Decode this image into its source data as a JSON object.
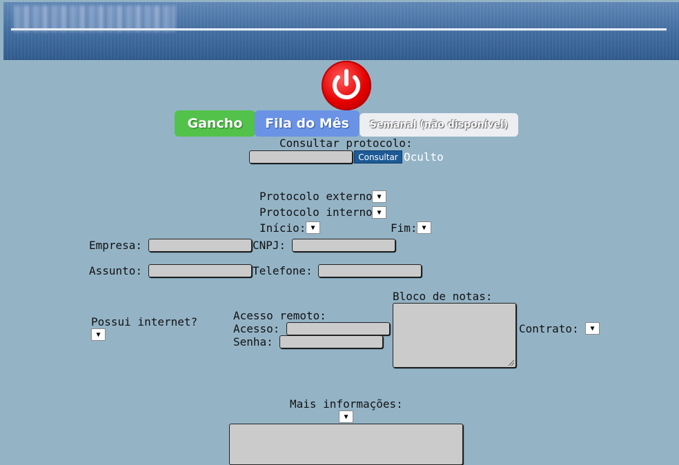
{
  "header": {
    "title_blurred": ""
  },
  "tabs": [
    {
      "label": "Gancho"
    },
    {
      "label": "Fila do Mês"
    },
    {
      "label": "Semanal (não disponível)"
    }
  ],
  "consulta": {
    "label": "Consultar protocolo:",
    "input_value": "",
    "button_label": "Consultar",
    "status_text": "Oculto"
  },
  "filters": {
    "protocolo_externo": "Protocolo externo",
    "protocolo_interno": "Protocolo interno",
    "inicio": "Início:",
    "fim": "Fim:"
  },
  "form": {
    "empresa": "Empresa:",
    "cnpj": "CNPJ:",
    "assunto": "Assunto:",
    "telefone": "Telefone:",
    "possui_internet": "Possui internet?",
    "acesso_remoto": "Acesso remoto:",
    "acesso": "Acesso:",
    "senha": "Senha:",
    "bloco_notas": "Bloco de notas:",
    "contrato": "Contrato:",
    "mais_info": "Mais informações:"
  },
  "dropdown_glyph": "▼",
  "colors": {
    "background": "#94b4c6",
    "tab_gancho": "#52c24a",
    "tab_fila": "#6a93e6",
    "power": "#e50000",
    "button": "#1d5a96"
  }
}
